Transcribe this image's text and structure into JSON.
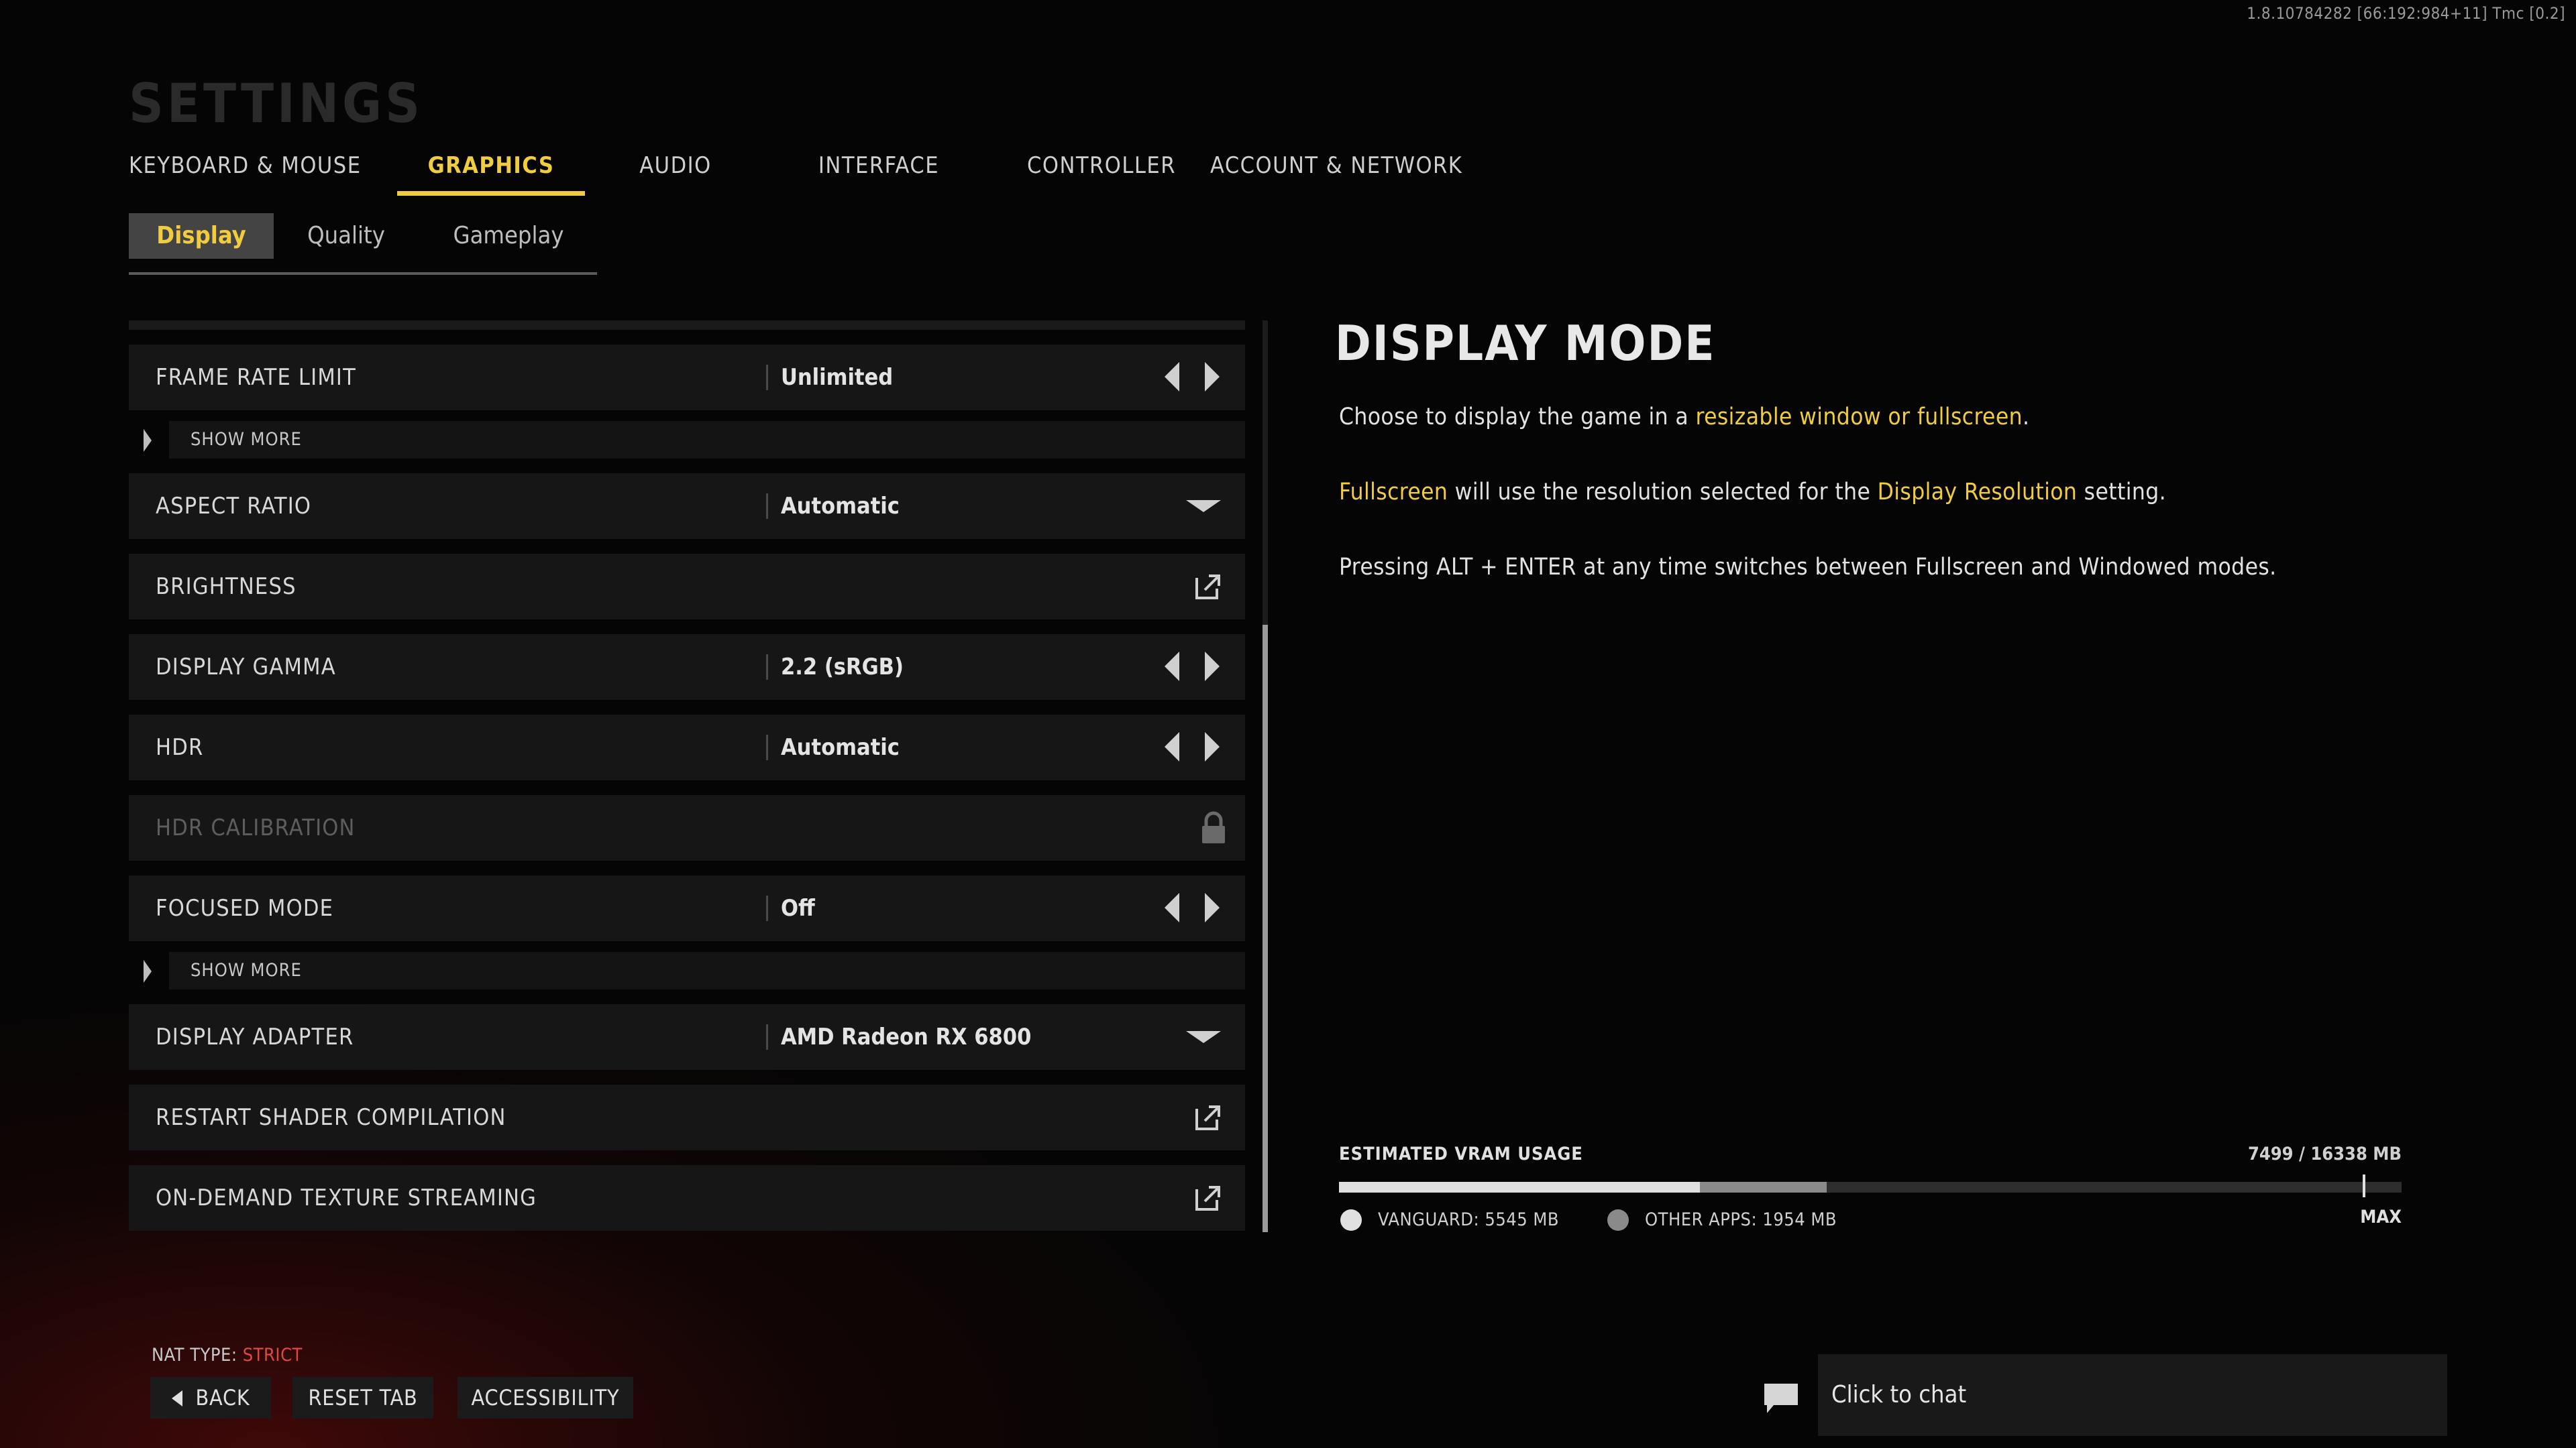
{
  "build_info": "1.8.10784282 [66:192:984+11] Tmc [0.2]",
  "page_title": "SETTINGS",
  "main_tabs": [
    {
      "label": "KEYBOARD & MOUSE",
      "active": false
    },
    {
      "label": "GRAPHICS",
      "active": true
    },
    {
      "label": "AUDIO",
      "active": false
    },
    {
      "label": "INTERFACE",
      "active": false
    },
    {
      "label": "CONTROLLER",
      "active": false
    },
    {
      "label": "ACCOUNT & NETWORK",
      "active": false
    }
  ],
  "sub_tabs": [
    {
      "label": "Display",
      "active": true
    },
    {
      "label": "Quality",
      "active": false
    },
    {
      "label": "Gameplay",
      "active": false
    }
  ],
  "settings": {
    "frame_rate_limit": {
      "label": "FRAME RATE LIMIT",
      "value": "Unlimited",
      "control": "arrows"
    },
    "show_more_1": {
      "label": "SHOW MORE"
    },
    "aspect_ratio": {
      "label": "ASPECT RATIO",
      "value": "Automatic",
      "control": "dropdown"
    },
    "brightness": {
      "label": "BRIGHTNESS",
      "control": "external"
    },
    "display_gamma": {
      "label": "DISPLAY GAMMA",
      "value": "2.2 (sRGB)",
      "control": "arrows"
    },
    "hdr": {
      "label": "HDR",
      "value": "Automatic",
      "control": "arrows"
    },
    "hdr_calibration": {
      "label": "HDR CALIBRATION",
      "control": "locked"
    },
    "focused_mode": {
      "label": "FOCUSED MODE",
      "value": "Off",
      "control": "arrows"
    },
    "show_more_2": {
      "label": "SHOW MORE"
    },
    "display_adapter": {
      "label": "DISPLAY ADAPTER",
      "value": "AMD Radeon RX 6800",
      "control": "dropdown"
    },
    "restart_shader": {
      "label": "RESTART SHADER COMPILATION",
      "control": "external"
    },
    "texture_streaming": {
      "label": "ON-DEMAND TEXTURE STREAMING",
      "control": "external"
    }
  },
  "description": {
    "title": "DISPLAY MODE",
    "p1_a": "Choose to display the game in a ",
    "p1_hl": "resizable window or fullscreen",
    "p1_b": ".",
    "p2_hl1": "Fullscreen",
    "p2_a": " will use the resolution selected for the ",
    "p2_hl2": "Display Resolution",
    "p2_b": " setting.",
    "p3": "Pressing ALT + ENTER at any time switches between Fullscreen and Windowed modes."
  },
  "vram": {
    "label": "ESTIMATED VRAM USAGE",
    "usage_text": "7499 / 16338 MB",
    "total_mb": 16338,
    "vanguard_mb": 5545,
    "other_mb": 1954,
    "max_mb": 15700,
    "max_label": "MAX",
    "vanguard_label": "VANGUARD: 5545 MB",
    "other_label": "OTHER APPS: 1954 MB",
    "vanguard_color": "#e0e0e0",
    "other_color": "#8a8a8a"
  },
  "footer": {
    "nat_label": "NAT TYPE: ",
    "nat_value": "STRICT",
    "back_label": "BACK",
    "reset_label": "RESET TAB",
    "accessibility_label": "ACCESSIBILITY",
    "chat_label": "Click to chat"
  },
  "colors": {
    "accent": "#f0cc40",
    "nat_strict": "#e04848"
  },
  "icons": [
    "chevron-left-icon",
    "chevron-right-icon",
    "dropdown-caret-icon",
    "external-link-icon",
    "lock-icon",
    "chat-icon",
    "back-arrow-icon"
  ]
}
